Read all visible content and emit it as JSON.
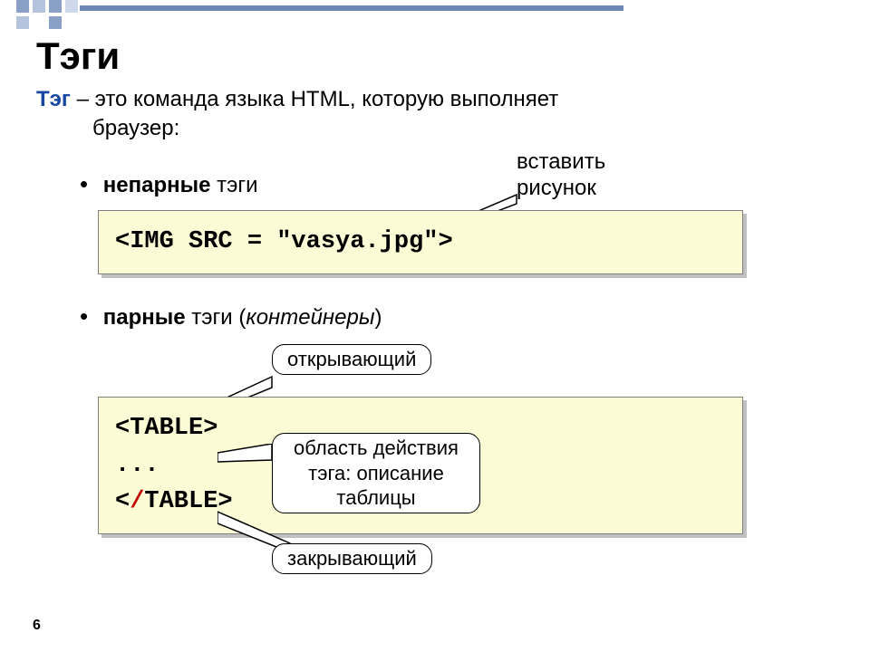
{
  "title": "Тэги",
  "definition": {
    "term": "Тэг",
    "rest1": " – это команда языка HTML, которую выполняет",
    "rest2": "браузер:"
  },
  "bullets": {
    "unpaired_bold": "непарные",
    "unpaired_rest": " тэги",
    "paired_bold": "парные",
    "paired_rest": " тэги (",
    "paired_italic": "контейнеры",
    "paired_close": ")"
  },
  "code": {
    "img_tag": "<IMG SRC = \"vasya.jpg\">",
    "table_open": "<TABLE>",
    "table_dots": "...",
    "table_close_pre": "<",
    "table_close_slash": "/",
    "table_close_post": "TABLE>"
  },
  "callouts": {
    "insert_line1": "вставить",
    "insert_line2": "рисунок",
    "opening": "открывающий",
    "scope_line1": "область действия",
    "scope_line2": "тэга: описание",
    "scope_line3": "таблицы",
    "closing": "закрывающий"
  },
  "page_number": "6"
}
